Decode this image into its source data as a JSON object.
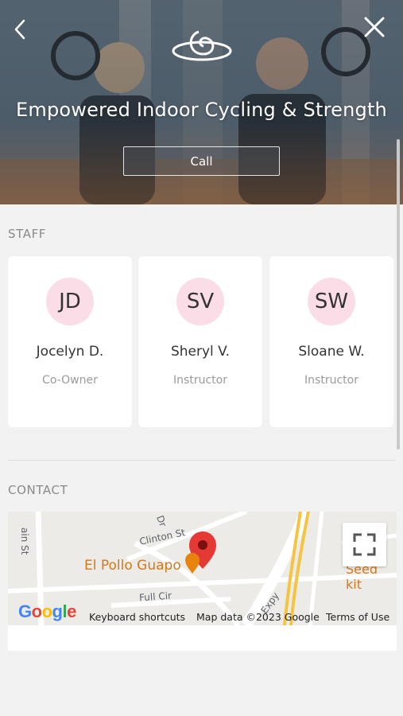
{
  "header": {
    "title": "Empowered Indoor Cycling & Strength",
    "call_label": "Call",
    "back_icon": "chevron-left-icon",
    "close_icon": "close-icon"
  },
  "staff": {
    "section_title": "STAFF",
    "members": [
      {
        "initials": "JD",
        "name": "Jocelyn D.",
        "role": "Co-Owner"
      },
      {
        "initials": "SV",
        "name": "Sheryl V.",
        "role": "Instructor"
      },
      {
        "initials": "SW",
        "name": "Sloane W.",
        "role": "Instructor"
      }
    ]
  },
  "contact": {
    "section_title": "CONTACT",
    "map": {
      "streets": [
        "ain St",
        "Clinton St",
        "Dr",
        "Full Cir",
        "Expy"
      ],
      "poi_left": "El Pollo Guapo",
      "poi_right": "Seed kit",
      "google_label": "Google",
      "keyboard_shortcuts": "Keyboard shortcuts",
      "map_data": "Map data ©2023 Google",
      "terms": "Terms of Use"
    }
  },
  "colors": {
    "avatar_bg": "#fbdde8",
    "section_title": "#8a8a8a",
    "poi_orange": "#d5781a",
    "pin_red": "#e53935"
  }
}
